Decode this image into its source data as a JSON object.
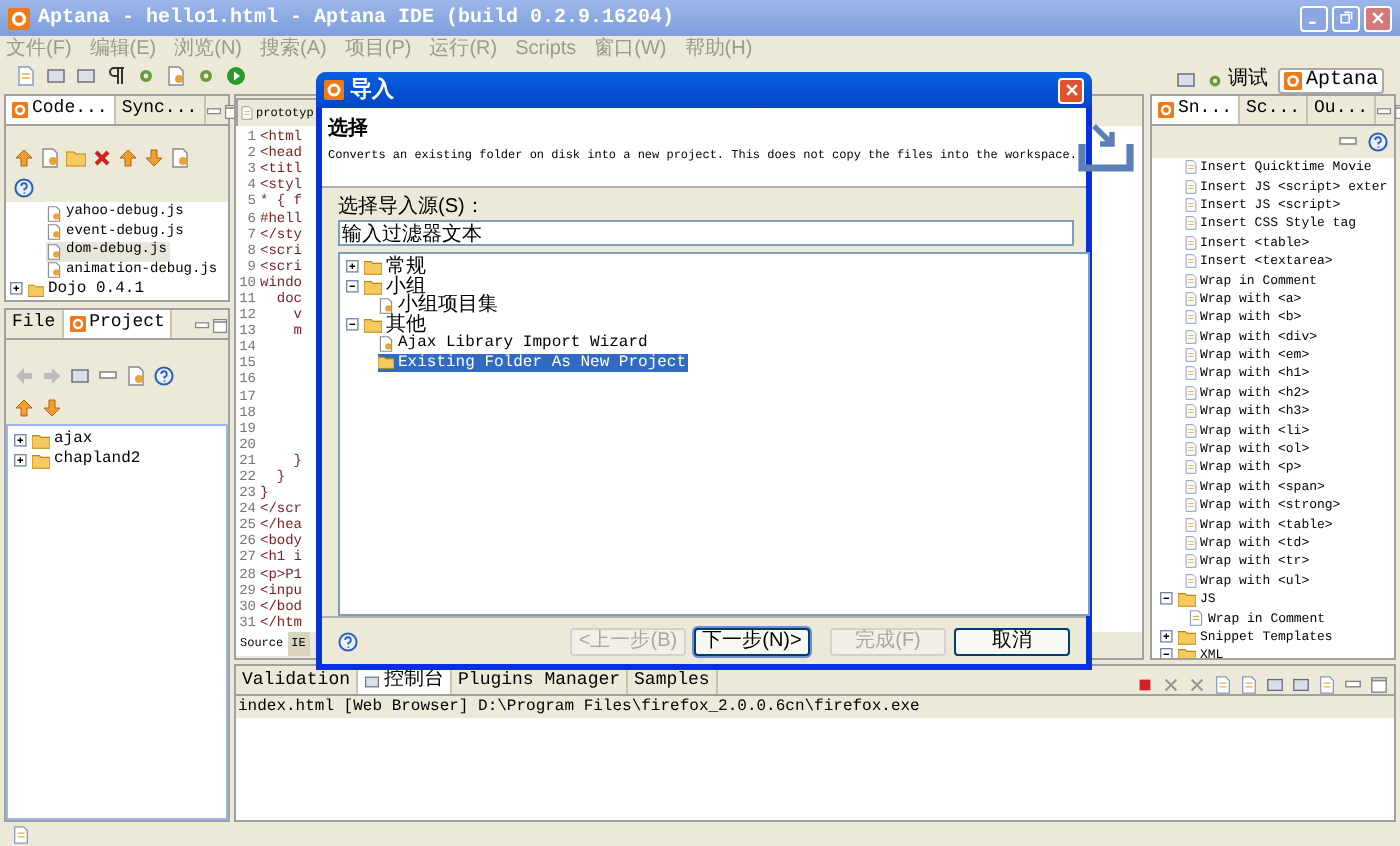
{
  "window": {
    "title": "Aptana - hello1.html - Aptana IDE (build 0.2.9.16204)"
  },
  "menu": [
    "文件(F)",
    "编辑(E)",
    "浏览(N)",
    "搜索(A)",
    "项目(P)",
    "运行(R)",
    "Scripts",
    "窗口(W)",
    "帮助(H)"
  ],
  "perspectives": [
    {
      "label": "调试",
      "selected": false
    },
    {
      "label": "Aptana",
      "selected": true
    }
  ],
  "code_panel": {
    "tabs": [
      {
        "label": "Code...",
        "selected": true
      },
      {
        "label": "Sync...",
        "selected": false
      }
    ],
    "files": [
      {
        "label": "yahoo-debug.js",
        "selected": false
      },
      {
        "label": "event-debug.js",
        "selected": false
      },
      {
        "label": "dom-debug.js",
        "selected": true
      },
      {
        "label": "animation-debug.js",
        "selected": false
      }
    ],
    "folder": "Dojo 0.4.1"
  },
  "project_panel": {
    "tabs": [
      {
        "label": "File",
        "selected": false
      },
      {
        "label": "Project",
        "selected": true
      }
    ],
    "items": [
      "ajax",
      "chapland2"
    ]
  },
  "editor": {
    "tab": "prototyp",
    "lines": [
      {
        "number": "1",
        "text": "<html"
      },
      {
        "number": "2",
        "text": "<head"
      },
      {
        "number": "3",
        "text": "<titl"
      },
      {
        "number": "4",
        "text": "<styl"
      },
      {
        "number": "5",
        "text": "* { f"
      },
      {
        "number": "6",
        "text": "#hell"
      },
      {
        "number": "7",
        "text": "</sty"
      },
      {
        "number": "8",
        "text": "<scri"
      },
      {
        "number": "9",
        "text": "<scri"
      },
      {
        "number": "10",
        "text": "windo"
      },
      {
        "number": "11",
        "text": "  doc"
      },
      {
        "number": "12",
        "text": "    v"
      },
      {
        "number": "13",
        "text": "    m"
      },
      {
        "number": "14"
      },
      {
        "number": "15"
      },
      {
        "number": "16"
      },
      {
        "number": "17"
      },
      {
        "number": "18"
      },
      {
        "number": "19"
      },
      {
        "number": "20"
      },
      {
        "number": "21",
        "text": "    }"
      },
      {
        "number": "22",
        "text": "  }"
      },
      {
        "number": "23",
        "text": "}"
      },
      {
        "number": "24",
        "text": "</scr"
      },
      {
        "number": "25",
        "text": "</hea"
      },
      {
        "number": "26",
        "text": "<body"
      },
      {
        "number": "27",
        "text": "<h1 i"
      },
      {
        "number": "28",
        "text": "<p>P1"
      },
      {
        "number": "29",
        "text": "<inpu"
      },
      {
        "number": "30",
        "text": "</bod"
      },
      {
        "number": "31",
        "text": "</htm"
      }
    ],
    "bottom_tabs": [
      {
        "label": "Source",
        "selected": true
      },
      {
        "label": "IE",
        "selected": false
      }
    ]
  },
  "snippets_panel": {
    "tabs": [
      {
        "label": "Sn...",
        "selected": true
      },
      {
        "label": "Sc...",
        "selected": false
      },
      {
        "label": "Ou...",
        "selected": false
      }
    ],
    "items": [
      "Insert Quicktime Movie",
      "Insert JS <script> exter",
      "Insert JS <script>",
      "Insert CSS Style tag",
      "Insert <table>",
      "Insert <textarea>",
      "Wrap in Comment",
      "Wrap with <a>",
      "Wrap with <b>",
      "Wrap with <div>",
      "Wrap with <em>",
      "Wrap with <h1>",
      "Wrap with <h2>",
      "Wrap with <h3>",
      "Wrap with <li>",
      "Wrap with <ol>",
      "Wrap with <p>",
      "Wrap with <span>",
      "Wrap with <strong>",
      "Wrap with <table>",
      "Wrap with <td>",
      "Wrap with <tr>",
      "Wrap with <ul>"
    ],
    "folders": [
      {
        "label": "JS",
        "expanded": true,
        "children": [
          "Wrap in Comment"
        ]
      },
      {
        "label": "Snippet Templates",
        "expanded": false
      },
      {
        "label": "XML",
        "expanded": true
      }
    ]
  },
  "console_panel": {
    "tabs": [
      {
        "label": "Validation",
        "selected": false
      },
      {
        "label": "控制台",
        "selected": true
      },
      {
        "label": "Plugins Manager",
        "selected": false
      },
      {
        "label": "Samples",
        "selected": false
      }
    ],
    "output": "index.html [Web Browser] D:\\Program Files\\firefox_2.0.0.6cn\\firefox.exe"
  },
  "dialog": {
    "title": "导入",
    "header_title": "选择",
    "description": "Converts an existing folder on disk into a new project. This does not copy the files into the workspace.",
    "source_label": "选择导入源(S)：",
    "filter": "输入过滤器文本",
    "tree": [
      {
        "label": "常规",
        "expanded": false
      },
      {
        "label": "小组",
        "expanded": true,
        "children": [
          {
            "label": "小组项目集",
            "selected": false
          }
        ]
      },
      {
        "label": "其他",
        "expanded": true,
        "children": [
          {
            "label": "Ajax Library Import Wizard",
            "selected": false
          },
          {
            "label": "Existing Folder As New Project",
            "selected": true
          }
        ]
      }
    ],
    "buttons": [
      {
        "label": "<上一步(B)",
        "disabled": true,
        "default": false
      },
      {
        "label": "下一步(N)>",
        "disabled": false,
        "default": true
      },
      {
        "label": "完成(F)",
        "disabled": true,
        "default": false
      },
      {
        "label": "取消",
        "disabled": false,
        "default": false
      }
    ]
  }
}
